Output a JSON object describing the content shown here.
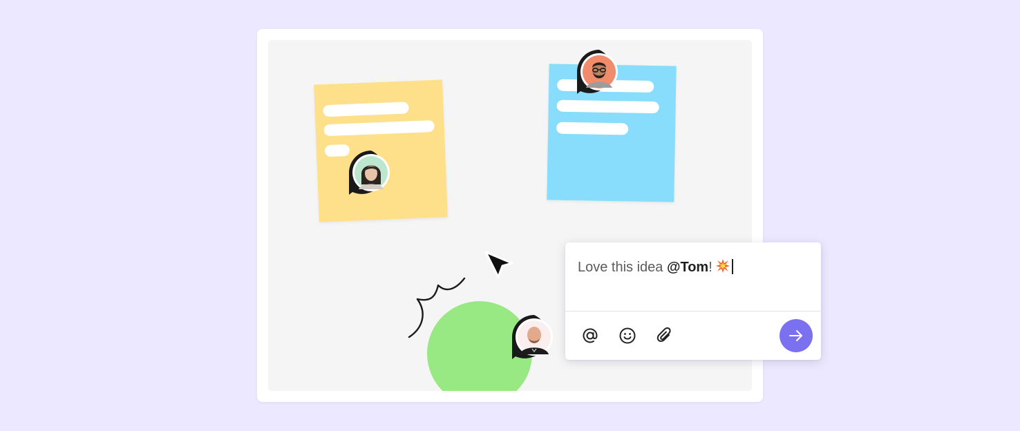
{
  "board": {
    "sticky_notes": [
      {
        "name": "yellow",
        "color": "#ffe08a"
      },
      {
        "name": "blue",
        "color": "#88ddfc"
      }
    ],
    "shapes": [
      {
        "name": "circle",
        "color": "#98e883"
      }
    ]
  },
  "collaborators": [
    {
      "name": "avatar-woman",
      "icon": "avatar-woman-icon"
    },
    {
      "name": "avatar-man-glasses",
      "icon": "avatar-man-glasses-icon"
    },
    {
      "name": "avatar-man-bald",
      "icon": "avatar-man-bald-icon"
    }
  ],
  "comment": {
    "text_before": "Love this idea ",
    "mention": "@Tom",
    "text_after": "!",
    "emoji": "collision-emoji-icon",
    "toolbar": {
      "mention_icon": "at-sign-icon",
      "emoji_icon": "smiley-icon",
      "attach_icon": "paperclip-icon",
      "send_icon": "arrow-right-icon"
    }
  },
  "colors": {
    "background": "#ebe8ff",
    "accent": "#7b71f0",
    "canvas": "#f5f5f5"
  }
}
